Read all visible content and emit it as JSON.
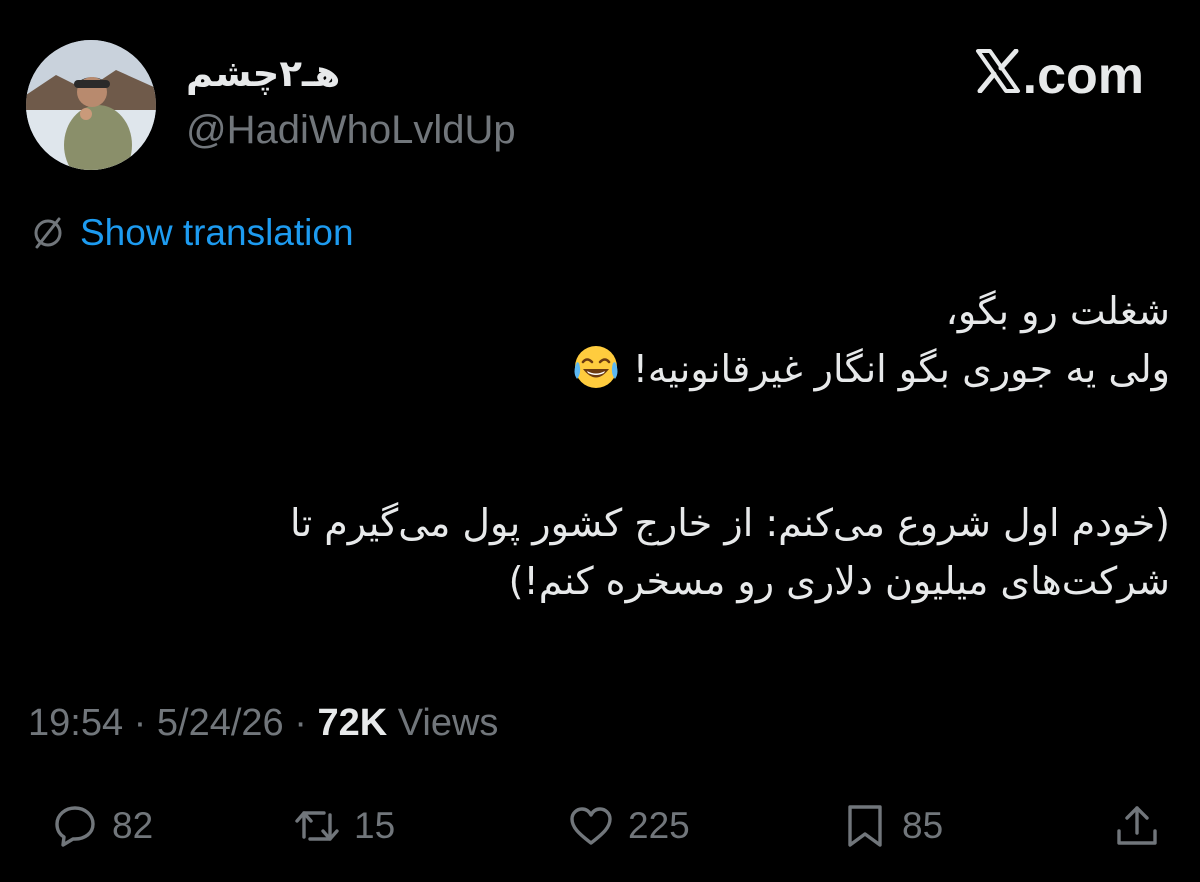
{
  "author": {
    "display_name": "هـ۲چشم",
    "handle": "@HadiWhoLvldUp"
  },
  "site": {
    "logo_text": ".com",
    "logo_icon": "x-logo-icon"
  },
  "translate": {
    "label": "Show translation",
    "icon": "globe-icon"
  },
  "tweet": {
    "line1": "شغلت رو بگو،",
    "line2": "ولی یه جوری بگو انگار غیرقانونیه!",
    "line2_emoji": "face-with-tears-of-joy",
    "line3": "(خودم اول شروع می‌کنم: از خارج کشور پول می‌گیرم تا",
    "line4": "شرکت‌های میلیون دلاری رو مسخره کنم!)"
  },
  "meta": {
    "time": "19:54",
    "sep1": " · ",
    "date": "5/24/26",
    "sep2": " · ",
    "views_count": "72K",
    "views_label": " Views"
  },
  "actions": {
    "replies": "82",
    "reposts": "15",
    "likes": "225",
    "bookmarks": "85"
  },
  "colors": {
    "background": "#000000",
    "text": "#e7e9ea",
    "muted": "#71767b",
    "link": "#1d9bf0"
  }
}
